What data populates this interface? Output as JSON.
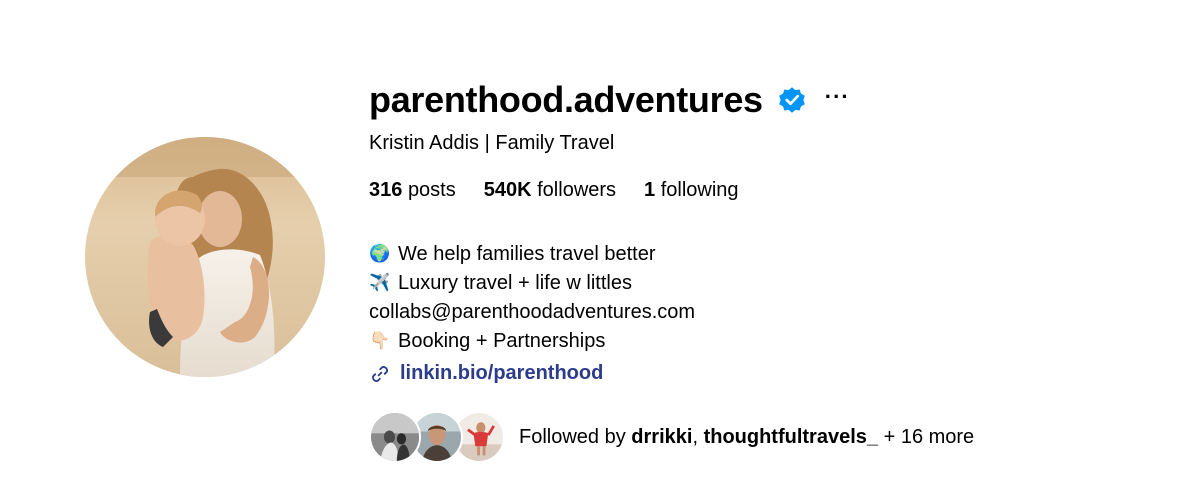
{
  "profile": {
    "username": "parenthood.adventures",
    "full_name": "Kristin Addis | Family Travel",
    "verified": true,
    "more_label": "···"
  },
  "stats": {
    "posts_count": "316",
    "posts_label": "posts",
    "followers_count": "540K",
    "followers_label": "followers",
    "following_count": "1",
    "following_label": "following"
  },
  "bio": {
    "lines": [
      {
        "icon": "globe-emoji",
        "glyph": "🌍",
        "text": "We help families travel better"
      },
      {
        "icon": "airplane-emoji",
        "glyph": "✈️",
        "text": "Luxury travel + life w littles"
      },
      {
        "icon": "",
        "glyph": "",
        "text": "collabs@parenthoodadventures.com"
      },
      {
        "icon": "pointing-down-emoji",
        "glyph": "👇🏻",
        "text": "Booking + Partnerships"
      }
    ]
  },
  "link": {
    "icon": "link-icon",
    "text": "linkin.bio/parenthood"
  },
  "followed_by": {
    "prefix": "Followed by",
    "user1": "drrikki",
    "separator": ",",
    "user2": "thoughtfultravels_",
    "suffix": "+ 16 more"
  },
  "colors": {
    "link": "#2d3b8c",
    "verified": "#0095f6"
  }
}
